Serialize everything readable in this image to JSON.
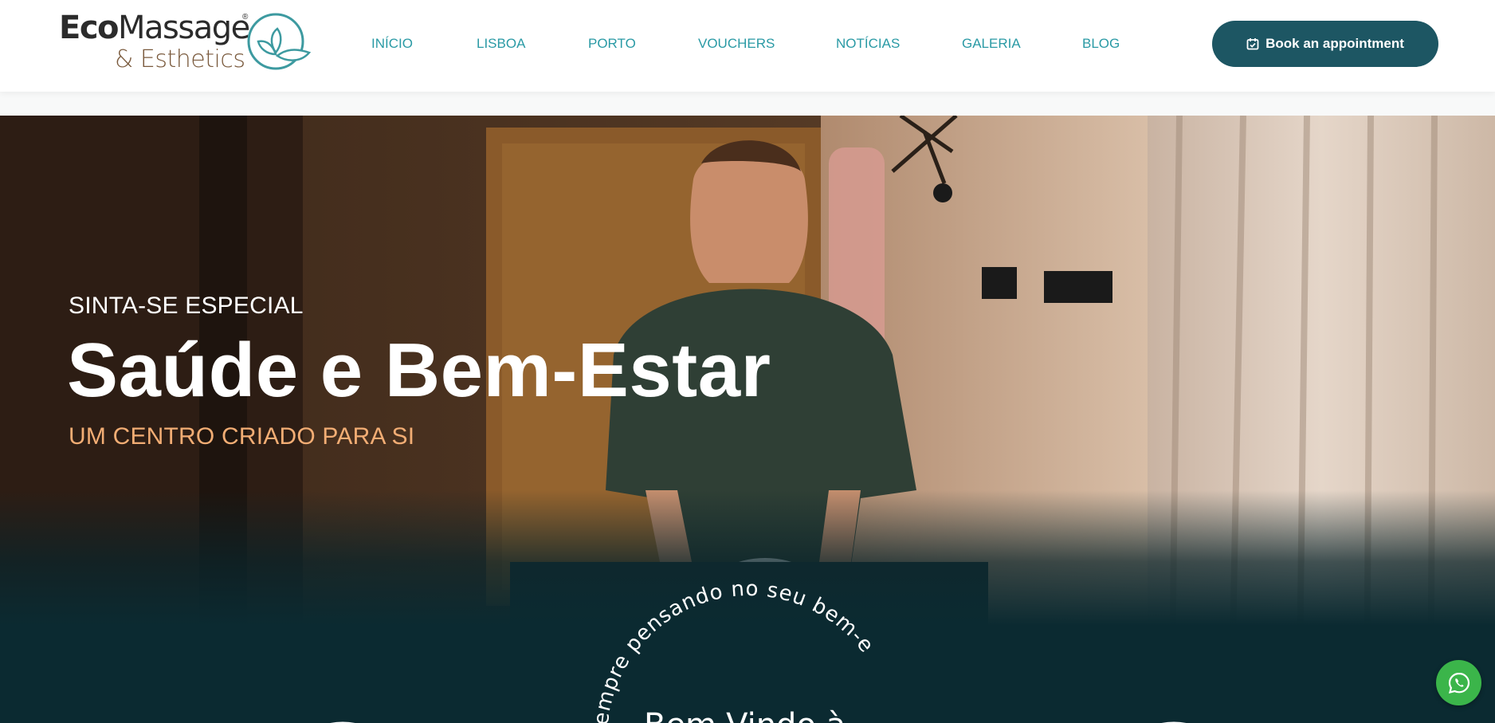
{
  "brand": {
    "name_bold": "Eco",
    "name_regular": "Massage",
    "registered": "®",
    "tagline": "& Esthetics",
    "color_primary": "#1d5663",
    "color_accent": "#2a9aa5",
    "color_brown": "#7a5a3d"
  },
  "nav": {
    "items": [
      {
        "label": "INÍCIO"
      },
      {
        "label": "LISBOA"
      },
      {
        "label": "PORTO"
      },
      {
        "label": "VOUCHERS"
      },
      {
        "label": "NOTÍCIAS"
      },
      {
        "label": "GALERIA"
      },
      {
        "label": "BLOG"
      }
    ]
  },
  "cta": {
    "label": "Book an appointment",
    "icon": "calendar-check-icon"
  },
  "hero": {
    "kicker": "SINTA-SE ESPECIAL",
    "title": "Saúde e Bem-Estar",
    "subtitle": "UM CENTRO CRIADO PARA SI",
    "subtitle_color": "#f2ad74",
    "arc_text": "sempre pensando no seu bem-e",
    "welcome": "Bem-Vindo à"
  },
  "floating": {
    "whatsapp_icon": "whatsapp-icon",
    "whatsapp_color": "#3bb54a"
  }
}
